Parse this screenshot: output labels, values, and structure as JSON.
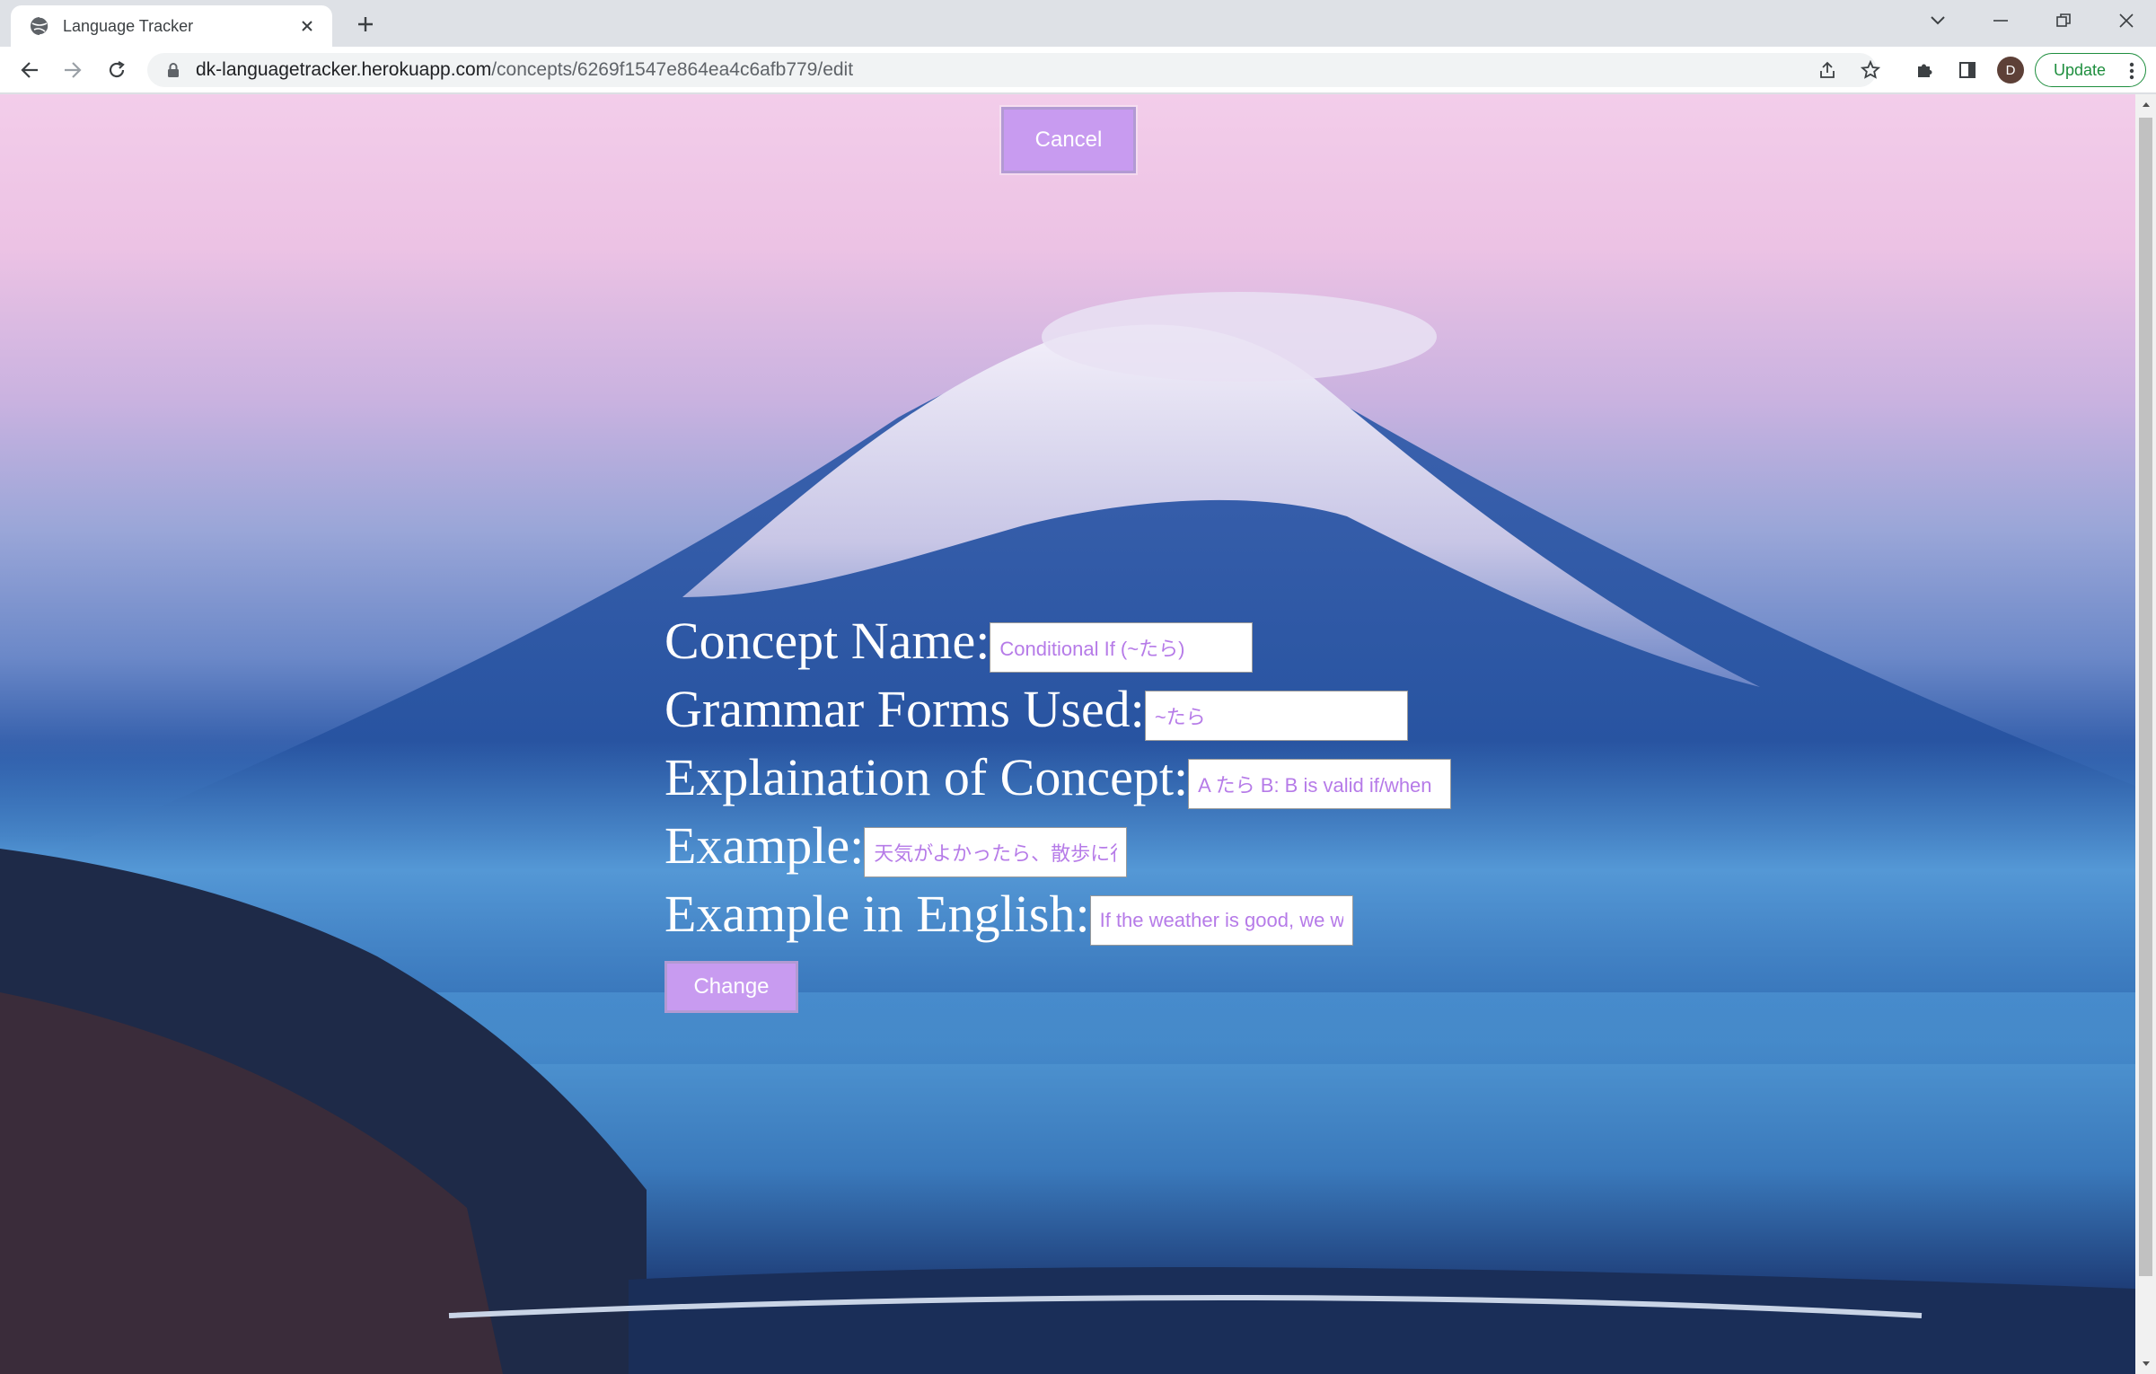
{
  "browser": {
    "tab_title": "Language Tracker",
    "url_host": "dk-languagetracker.herokuapp.com",
    "url_path": "/concepts/6269f1547e864ea4c6afb779/edit",
    "profile_initial": "D",
    "update_label": "Update"
  },
  "page": {
    "cancel_label": "Cancel",
    "fields": [
      {
        "label": "Concept Name:",
        "value": "Conditional If (~たら)"
      },
      {
        "label": "Grammar Forms Used:",
        "value": "~たら"
      },
      {
        "label": "Explaination of Concept:",
        "value": "A たら B: B is valid if/when"
      },
      {
        "label": "Example:",
        "value": "天気がよかったら、散歩に行きます"
      },
      {
        "label": "Example in English:",
        "value": "If the weather is good, we will go for a walk"
      }
    ],
    "submit_label": "Change"
  },
  "colors": {
    "button_bg": "#c89bf0",
    "field_text": "#b67be8",
    "update_green": "#1e8e3e"
  }
}
